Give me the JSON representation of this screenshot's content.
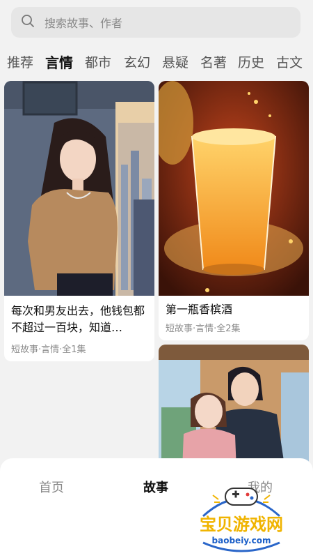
{
  "search": {
    "placeholder": "搜索故事、作者"
  },
  "tabs": [
    {
      "label": "推荐",
      "active": false
    },
    {
      "label": "言情",
      "active": true
    },
    {
      "label": "都市",
      "active": false
    },
    {
      "label": "玄幻",
      "active": false
    },
    {
      "label": "悬疑",
      "active": false
    },
    {
      "label": "名著",
      "active": false
    },
    {
      "label": "历史",
      "active": false
    },
    {
      "label": "古文",
      "active": false
    }
  ],
  "cards": [
    {
      "title": "每次和男友出去，他钱包都不超过一百块，知道…",
      "meta": "短故事·言情·全1集"
    },
    {
      "title": "第一瓶香槟酒",
      "meta": "短故事·言情·全2集"
    },
    {
      "title": "",
      "meta": ""
    }
  ],
  "bottom_nav": [
    {
      "label": "首页",
      "active": false
    },
    {
      "label": "故事",
      "active": true
    },
    {
      "label": "我的",
      "active": false
    }
  ],
  "watermark": {
    "title": "宝贝游戏网",
    "url": "baobeiy.com"
  },
  "colors": {
    "accent_tab": "#111111",
    "watermark_gold": "#f0b400",
    "watermark_blue": "#1b5fc8"
  }
}
